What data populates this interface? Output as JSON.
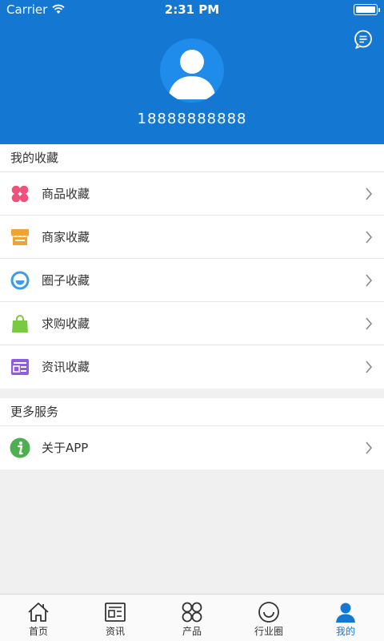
{
  "status_bar": {
    "carrier": "Carrier",
    "time": "2:31 PM"
  },
  "profile": {
    "phone": "18888888888"
  },
  "favorites": {
    "title": "我的收藏",
    "items": [
      {
        "label": "商品收藏",
        "icon": "clover-icon",
        "color": "#f0507a"
      },
      {
        "label": "商家收藏",
        "icon": "store-icon",
        "color": "#f0a332"
      },
      {
        "label": "圈子收藏",
        "icon": "smile-circle-icon",
        "color": "#3d9be9"
      },
      {
        "label": "求购收藏",
        "icon": "shopping-bag-icon",
        "color": "#7ac943"
      },
      {
        "label": "资讯收藏",
        "icon": "news-card-icon",
        "color": "#8c5ce6"
      }
    ]
  },
  "services": {
    "title": "更多服务",
    "items": [
      {
        "label": "关于APP",
        "icon": "info-icon",
        "color": "#4caf50"
      }
    ]
  },
  "tabbar": {
    "items": [
      {
        "label": "首页",
        "icon": "home-icon"
      },
      {
        "label": "资讯",
        "icon": "news-icon"
      },
      {
        "label": "产品",
        "icon": "grid-petals-icon"
      },
      {
        "label": "行业圈",
        "icon": "smile-circle-icon"
      },
      {
        "label": "我的",
        "icon": "user-icon",
        "active": true
      }
    ]
  },
  "colors": {
    "primary": "#1478d2",
    "background": "#f0f0f0"
  }
}
